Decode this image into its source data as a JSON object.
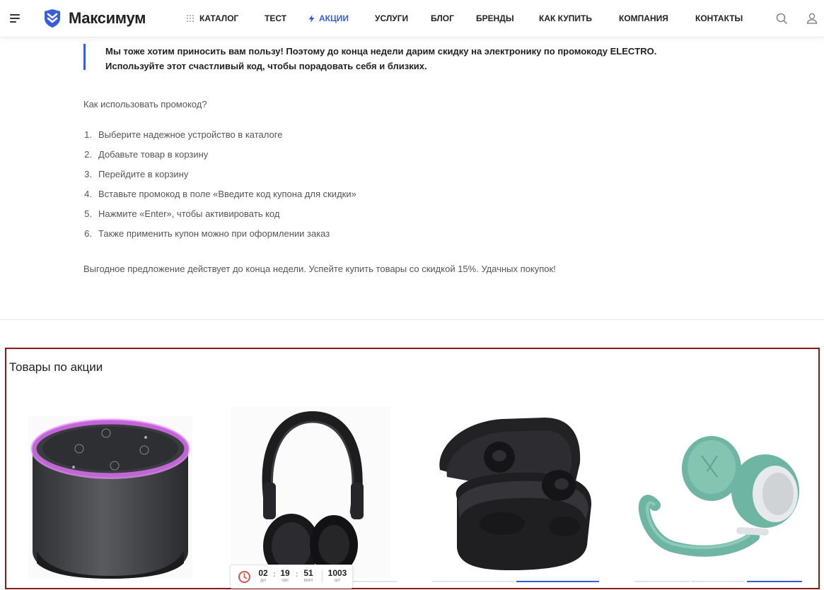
{
  "header": {
    "logo": "Максимум",
    "nav": [
      {
        "label": "КАТАЛОГ",
        "icon": "grid-dots-icon"
      },
      {
        "label": "ТЕСТ"
      },
      {
        "label": "АКЦИИ",
        "icon": "lightning-icon",
        "active": true
      },
      {
        "label": "УСЛУГИ"
      },
      {
        "label": "БЛОГ"
      },
      {
        "label": "БРЕНДЫ"
      },
      {
        "label": "КАК КУПИТЬ"
      },
      {
        "label": "КОМПАНИЯ"
      },
      {
        "label": "КОНТАКТЫ"
      }
    ],
    "icons": [
      "menu-icon",
      "search-icon",
      "user-icon"
    ]
  },
  "article": {
    "quote_line1": "Мы тоже хотим приносить вам пользу! Поэтому до конца недели дарим скидку на электронику по промокоду ELECTRO.",
    "quote_line2": "Используйте этот счастливый код, чтобы порадовать себя и близких.",
    "howto": "Как использовать промокод?",
    "steps": [
      {
        "num": "1.",
        "text": "Выберите надежное устройство в каталоге"
      },
      {
        "num": "2.",
        "text": "Добавьте товар в корзину"
      },
      {
        "num": "3.",
        "text": "Перейдите в корзину"
      },
      {
        "num": "4.",
        "text": "Вставьте промокод в поле «Введите код купона для скидки»"
      },
      {
        "num": "5.",
        "text": "Нажмите «Enter», чтобы активировать код"
      },
      {
        "num": "6.",
        "text": "Также применить купон можно при оформлении заказ"
      }
    ],
    "closing": "Выгодное предложение действует до конца недели. Успейте купить товары со скидкой 15%. Удачных покупок!"
  },
  "promo": {
    "title": "Товары по акции",
    "products": [
      {
        "icon": "smart-speaker-icon"
      },
      {
        "icon": "headphones-black-icon"
      },
      {
        "icon": "wireless-earbuds-icon"
      },
      {
        "icon": "headphones-mint-icon"
      }
    ],
    "timer": {
      "days": "02",
      "days_label": "дн",
      "hours": "19",
      "hours_label": "час",
      "minutes": "51",
      "minutes_label": "мин",
      "stock": "1003",
      "stock_label": "шт"
    }
  },
  "colors": {
    "accent": "#365edc",
    "frame": "#8b1a1a",
    "timer_icon": "#d9534f"
  }
}
